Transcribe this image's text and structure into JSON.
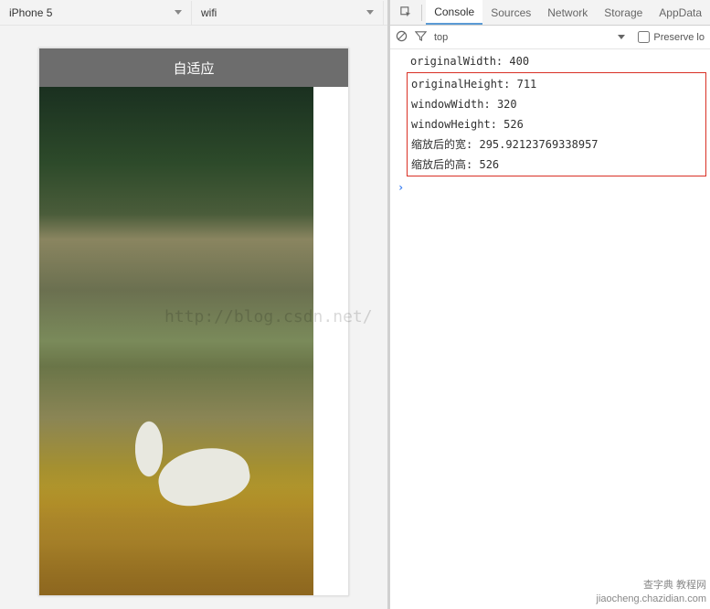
{
  "toolbar": {
    "device": "iPhone 5",
    "network": "wifi"
  },
  "simulator": {
    "header_title": "自适应"
  },
  "devtools": {
    "tabs": [
      "Console",
      "Sources",
      "Network",
      "Storage",
      "AppData"
    ],
    "active_tab": "Console",
    "filter_context": "top",
    "preserve_label": "Preserve lo"
  },
  "console_logs": [
    {
      "key": "originalWidth",
      "value": "400"
    },
    {
      "key": "originalHeight",
      "value": "711"
    },
    {
      "key": "windowWidth",
      "value": "320"
    },
    {
      "key": "windowHeight",
      "value": "526"
    },
    {
      "key": "缩放后的宽",
      "value": "295.92123769338957"
    },
    {
      "key": "缩放后的高",
      "value": "526"
    }
  ],
  "watermark": "http://blog.csdn.net/",
  "corner": {
    "line1": "查字典 教程网",
    "line2": "jiaocheng.chazidian.com"
  }
}
